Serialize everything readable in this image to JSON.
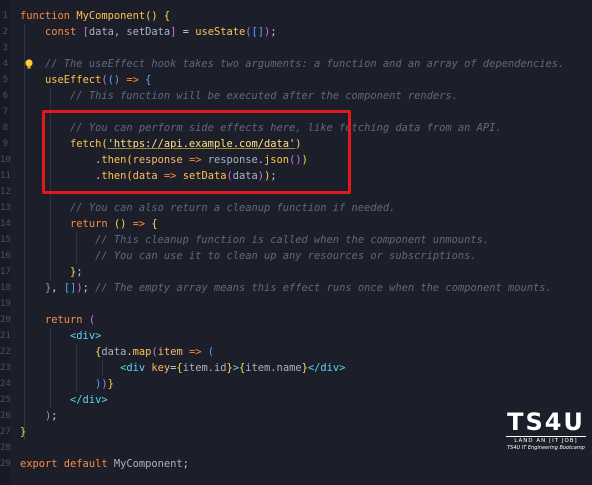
{
  "editor": {
    "lines": [
      [
        {
          "t": "k",
          "v": "function "
        },
        {
          "t": "f",
          "v": "MyComponent"
        },
        {
          "t": "b1",
          "v": "() {"
        }
      ],
      [
        {
          "t": "v",
          "v": "    "
        },
        {
          "t": "k",
          "v": "const "
        },
        {
          "t": "b2",
          "v": "["
        },
        {
          "t": "v",
          "v": "data, setData"
        },
        {
          "t": "b2",
          "v": "]"
        },
        {
          "t": "p",
          "v": " = "
        },
        {
          "t": "f",
          "v": "useState"
        },
        {
          "t": "b2",
          "v": "("
        },
        {
          "t": "b3",
          "v": "[]"
        },
        {
          "t": "b2",
          "v": ")"
        },
        {
          "t": "p",
          "v": ";"
        }
      ],
      [],
      [
        {
          "t": "v",
          "v": "    "
        },
        {
          "t": "c",
          "v": "// The useEffect hook takes two arguments: a function and an array of dependencies."
        }
      ],
      [
        {
          "t": "v",
          "v": "    "
        },
        {
          "t": "f",
          "v": "useEffect"
        },
        {
          "t": "b2",
          "v": "("
        },
        {
          "t": "b3",
          "v": "()"
        },
        {
          "t": "k",
          "v": " => "
        },
        {
          "t": "b3",
          "v": "{"
        }
      ],
      [
        {
          "t": "v",
          "v": "        "
        },
        {
          "t": "c",
          "v": "// This function will be executed after the component renders."
        }
      ],
      [],
      [
        {
          "t": "v",
          "v": "        "
        },
        {
          "t": "c",
          "v": "// You can perform side effects here, like fetching data from an API."
        }
      ],
      [
        {
          "t": "v",
          "v": "        "
        },
        {
          "t": "f",
          "v": "fetch"
        },
        {
          "t": "b1",
          "v": "("
        },
        {
          "t": "s",
          "v": "'https://api.example.com/data'"
        },
        {
          "t": "b1",
          "v": ")"
        }
      ],
      [
        {
          "t": "v",
          "v": "            "
        },
        {
          "t": "p",
          "v": "."
        },
        {
          "t": "f",
          "v": "then"
        },
        {
          "t": "b1",
          "v": "("
        },
        {
          "t": "a",
          "v": "response"
        },
        {
          "t": "k",
          "v": " => "
        },
        {
          "t": "v",
          "v": "response"
        },
        {
          "t": "p",
          "v": "."
        },
        {
          "t": "f",
          "v": "json"
        },
        {
          "t": "b2",
          "v": "()"
        },
        {
          "t": "b1",
          "v": ")"
        }
      ],
      [
        {
          "t": "v",
          "v": "            "
        },
        {
          "t": "p",
          "v": "."
        },
        {
          "t": "f",
          "v": "then"
        },
        {
          "t": "b1",
          "v": "("
        },
        {
          "t": "a",
          "v": "data"
        },
        {
          "t": "k",
          "v": " => "
        },
        {
          "t": "f",
          "v": "setData"
        },
        {
          "t": "b2",
          "v": "("
        },
        {
          "t": "v",
          "v": "data"
        },
        {
          "t": "b2",
          "v": ")"
        },
        {
          "t": "b1",
          "v": ")"
        },
        {
          "t": "p",
          "v": ";"
        }
      ],
      [],
      [
        {
          "t": "v",
          "v": "        "
        },
        {
          "t": "c",
          "v": "// You can also return a cleanup function if needed."
        }
      ],
      [
        {
          "t": "v",
          "v": "        "
        },
        {
          "t": "k",
          "v": "return "
        },
        {
          "t": "b1",
          "v": "()"
        },
        {
          "t": "k",
          "v": " => "
        },
        {
          "t": "b1",
          "v": "{"
        }
      ],
      [
        {
          "t": "v",
          "v": "            "
        },
        {
          "t": "c",
          "v": "// This cleanup function is called when the component unmounts."
        }
      ],
      [
        {
          "t": "v",
          "v": "            "
        },
        {
          "t": "c",
          "v": "// You can use it to clean up any resources or subscriptions."
        }
      ],
      [
        {
          "t": "v",
          "v": "        "
        },
        {
          "t": "b1",
          "v": "}"
        },
        {
          "t": "p",
          "v": ";"
        }
      ],
      [
        {
          "t": "v",
          "v": "    "
        },
        {
          "t": "b3",
          "v": "}"
        },
        {
          "t": "p",
          "v": ", "
        },
        {
          "t": "b3",
          "v": "[]"
        },
        {
          "t": "b2",
          "v": ")"
        },
        {
          "t": "p",
          "v": "; "
        },
        {
          "t": "c",
          "v": "// The empty array means this effect runs once when the component mounts."
        }
      ],
      [],
      [
        {
          "t": "v",
          "v": "    "
        },
        {
          "t": "k",
          "v": "return "
        },
        {
          "t": "b2",
          "v": "("
        }
      ],
      [
        {
          "t": "v",
          "v": "        "
        },
        {
          "t": "t",
          "v": "<div>"
        }
      ],
      [
        {
          "t": "v",
          "v": "            "
        },
        {
          "t": "b1",
          "v": "{"
        },
        {
          "t": "v",
          "v": "data"
        },
        {
          "t": "p",
          "v": "."
        },
        {
          "t": "f",
          "v": "map"
        },
        {
          "t": "b2",
          "v": "("
        },
        {
          "t": "a",
          "v": "item"
        },
        {
          "t": "k",
          "v": " => "
        },
        {
          "t": "b3",
          "v": "("
        }
      ],
      [
        {
          "t": "v",
          "v": "                "
        },
        {
          "t": "t",
          "v": "<div "
        },
        {
          "t": "a",
          "v": "key"
        },
        {
          "t": "p",
          "v": "="
        },
        {
          "t": "b1",
          "v": "{"
        },
        {
          "t": "v",
          "v": "item.id"
        },
        {
          "t": "b1",
          "v": "}"
        },
        {
          "t": "t",
          "v": ">"
        },
        {
          "t": "b1",
          "v": "{"
        },
        {
          "t": "v",
          "v": "item.name"
        },
        {
          "t": "b1",
          "v": "}"
        },
        {
          "t": "t",
          "v": "</div>"
        }
      ],
      [
        {
          "t": "v",
          "v": "            "
        },
        {
          "t": "b3",
          "v": ")"
        },
        {
          "t": "b2",
          "v": ")"
        },
        {
          "t": "b1",
          "v": "}"
        }
      ],
      [
        {
          "t": "v",
          "v": "        "
        },
        {
          "t": "t",
          "v": "</div>"
        }
      ],
      [
        {
          "t": "v",
          "v": "    "
        },
        {
          "t": "b2",
          "v": ")"
        },
        {
          "t": "p",
          "v": ";"
        }
      ],
      [
        {
          "t": "b1",
          "v": "}"
        }
      ],
      [],
      [
        {
          "t": "k",
          "v": "export default "
        },
        {
          "t": "v",
          "v": "MyComponent"
        },
        {
          "t": "p",
          "v": ";"
        }
      ]
    ]
  },
  "logo": {
    "main": "TS4U",
    "tagline": "LAND AN [IT JOB]",
    "subtitle": "TS4U IT Engineering Bootcamp"
  }
}
